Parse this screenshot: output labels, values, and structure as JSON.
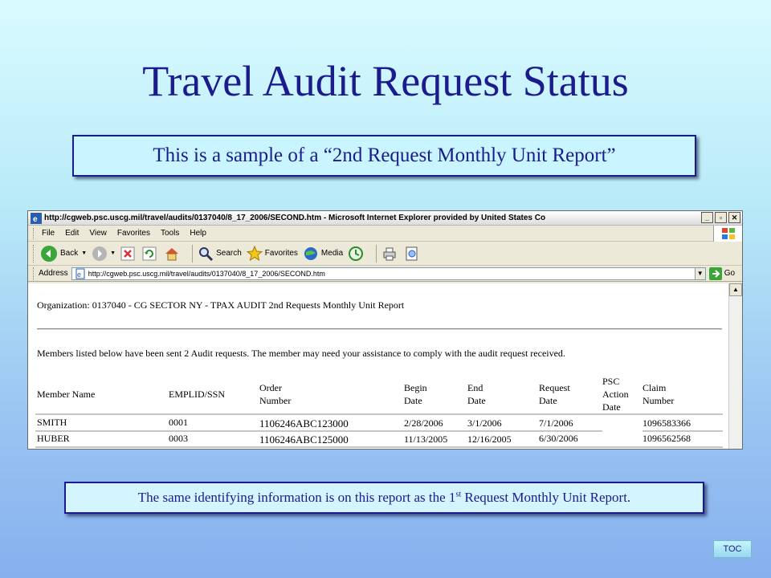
{
  "slide": {
    "title": "Travel Audit Request Status",
    "subtitle": "This is a sample of a “2nd Request Monthly Unit Report”",
    "note_before": "The same identifying information is on this report as the 1",
    "note_sup": "st",
    "note_after": " Request Monthly Unit Report.",
    "toc_label": "TOC"
  },
  "browser": {
    "window_title": "http://cgweb.psc.uscg.mil/travel/audits/0137040/8_17_2006/SECOND.htm - Microsoft Internet Explorer provided by United States Co",
    "menu": [
      "File",
      "Edit",
      "View",
      "Favorites",
      "Tools",
      "Help"
    ],
    "toolbar": {
      "back": "Back",
      "search": "Search",
      "favorites": "Favorites",
      "media": "Media"
    },
    "address_label": "Address",
    "address_value": "http://cgweb.psc.uscg.mil/travel/audits/0137040/8_17_2006/SECOND.htm",
    "go_label": "Go"
  },
  "report": {
    "organization": "Organization: 0137040 - CG SECTOR NY - TPAX AUDIT 2nd Requests Monthly Unit Report",
    "members_note": "Members listed below have been sent 2 Audit requests. The member may need your assistance to comply with the audit request received.",
    "headers": {
      "member_name": "Member Name",
      "emplid": "EMPLID/SSN",
      "order_1": "Order",
      "order_2": "Number",
      "begin_1": "Begin",
      "begin_2": "Date",
      "end_1": "End",
      "end_2": "Date",
      "request_1": "Request",
      "request_2": "Date",
      "psc_1": "PSC",
      "psc_2": "Action",
      "psc_3": "Date",
      "claim_1": "Claim",
      "claim_2": "Number"
    },
    "rows": [
      {
        "name": "SMITH",
        "emplid": "0001",
        "order": "1106246ABC123000",
        "begin": "2/28/2006",
        "end": "3/1/2006",
        "request": "7/1/2006",
        "claim": "1096583366"
      },
      {
        "name": "HUBER",
        "emplid": "0003",
        "order": "1106246ABC125000",
        "begin": "11/13/2005",
        "end": "12/16/2005",
        "request": "6/30/2006",
        "claim": "1096562568"
      }
    ]
  }
}
